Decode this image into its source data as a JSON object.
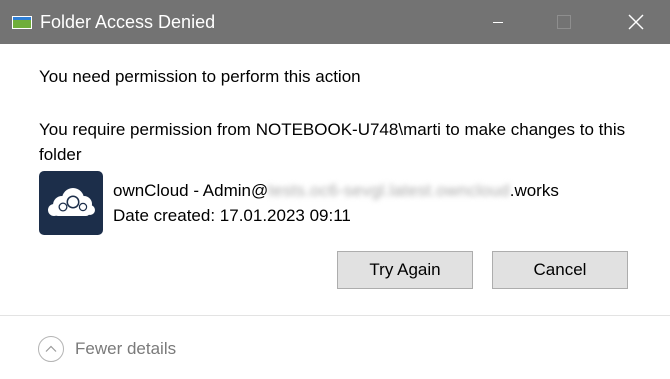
{
  "window": {
    "title": "Folder Access Denied",
    "minimize_icon": "minimize-icon",
    "maximize_icon": "maximize-icon",
    "close_icon": "close-icon",
    "titlebar_color": "#737373"
  },
  "message": {
    "heading": "You need permission to perform this action",
    "detail": "You require permission from NOTEBOOK-U748\\marti to make changes to this folder"
  },
  "item": {
    "icon": "owncloud-logo-icon",
    "name_prefix": "ownCloud - Admin@",
    "name_redacted": "tests.oc6-sevgl.latest.owncloud",
    "name_suffix": ".works",
    "date_created": "Date created: 17.01.2023 09:11"
  },
  "buttons": {
    "try_again": "Try Again",
    "cancel": "Cancel"
  },
  "details_toggle": {
    "label": "Fewer details",
    "icon": "chevron-up-icon"
  }
}
